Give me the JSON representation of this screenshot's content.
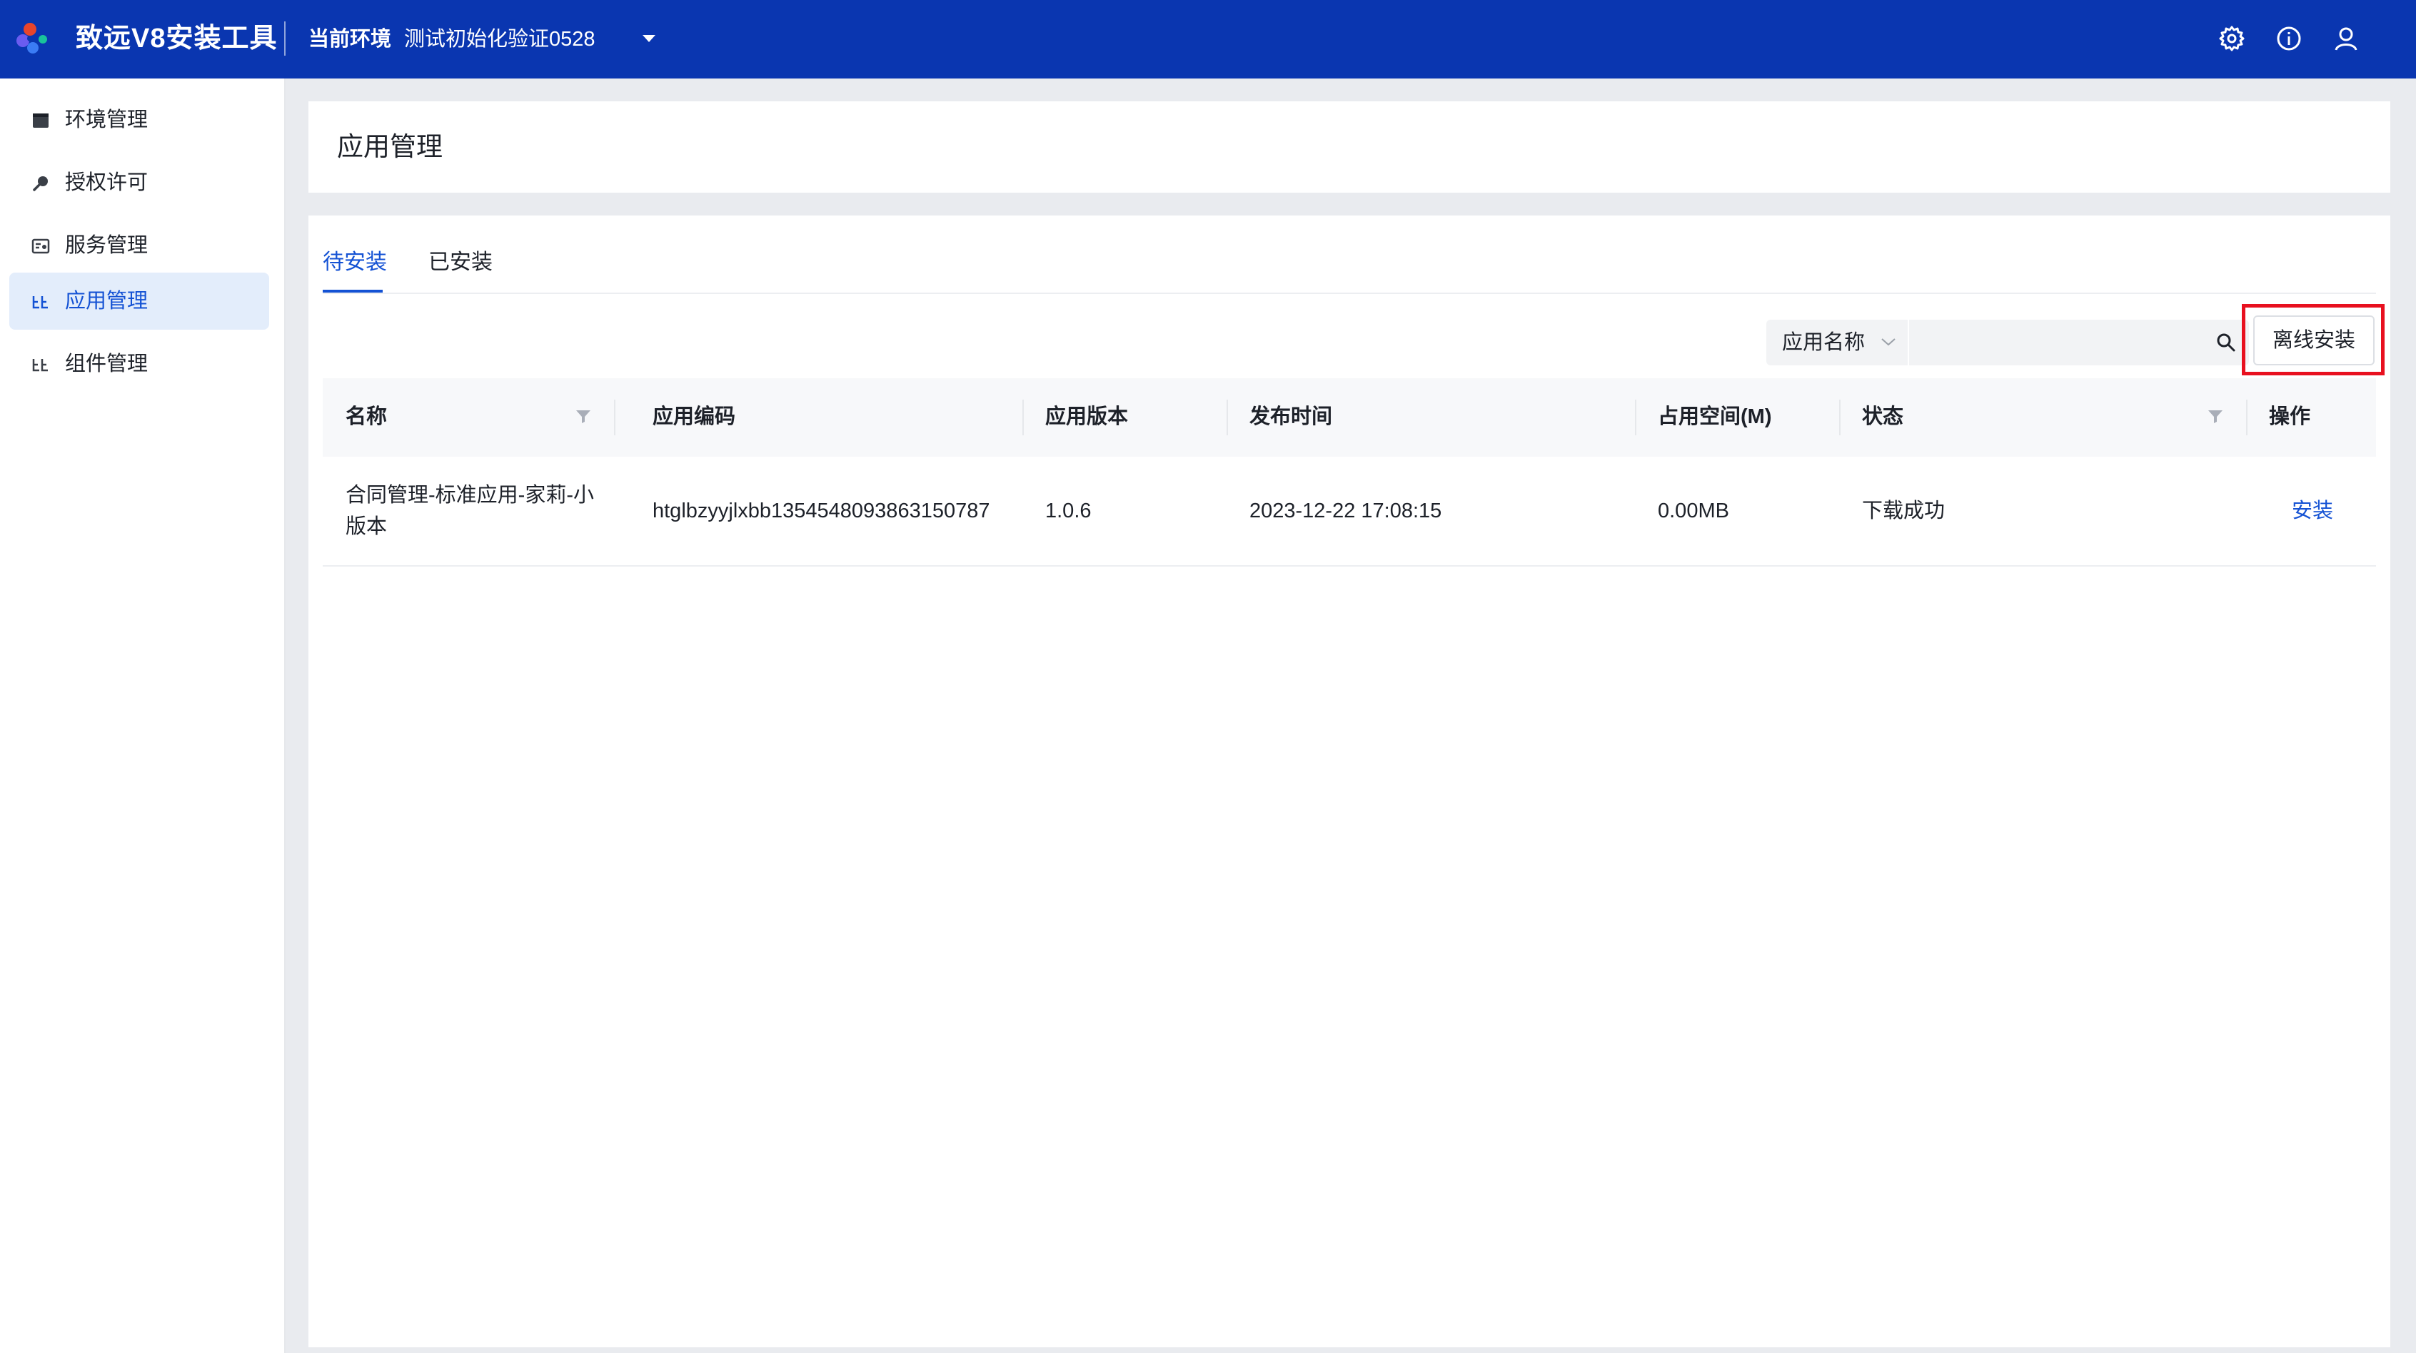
{
  "app": {
    "title": "致远V8安装工具",
    "env_label": "当前环境",
    "env_value": "测试初始化验证0528"
  },
  "topbar_icons": [
    "gear-icon",
    "info-icon",
    "user-icon"
  ],
  "sidebar": {
    "items": [
      {
        "label": "环境管理",
        "icon": "environment-icon",
        "active": false
      },
      {
        "label": "授权许可",
        "icon": "license-key-icon",
        "active": false
      },
      {
        "label": "服务管理",
        "icon": "service-icon",
        "active": false
      },
      {
        "label": "应用管理",
        "icon": "app-icon",
        "active": true
      },
      {
        "label": "组件管理",
        "icon": "component-icon",
        "active": false
      }
    ]
  },
  "page": {
    "title": "应用管理"
  },
  "tabs": [
    {
      "label": "待安装",
      "active": true
    },
    {
      "label": "已安装",
      "active": false
    }
  ],
  "search": {
    "field_label": "应用名称",
    "value": "",
    "placeholder": ""
  },
  "toolbar": {
    "offline_install_label": "离线安装"
  },
  "table": {
    "columns": [
      "名称",
      "应用编码",
      "应用版本",
      "发布时间",
      "占用空间(M)",
      "状态",
      "操作"
    ],
    "rows": [
      {
        "name": "合同管理-标准应用-家莉-小版本",
        "code": "htglbzyyjlxbb1354548093863150787",
        "version": "1.0.6",
        "release_time": "2023-12-22 17:08:15",
        "size": "0.00MB",
        "status": "下载成功",
        "action": "安装"
      }
    ]
  },
  "colors": {
    "topbar": "#0a36b0",
    "accent": "#1452d4",
    "active_nav_bg": "#e3edfb",
    "highlight": "#e8101f"
  }
}
